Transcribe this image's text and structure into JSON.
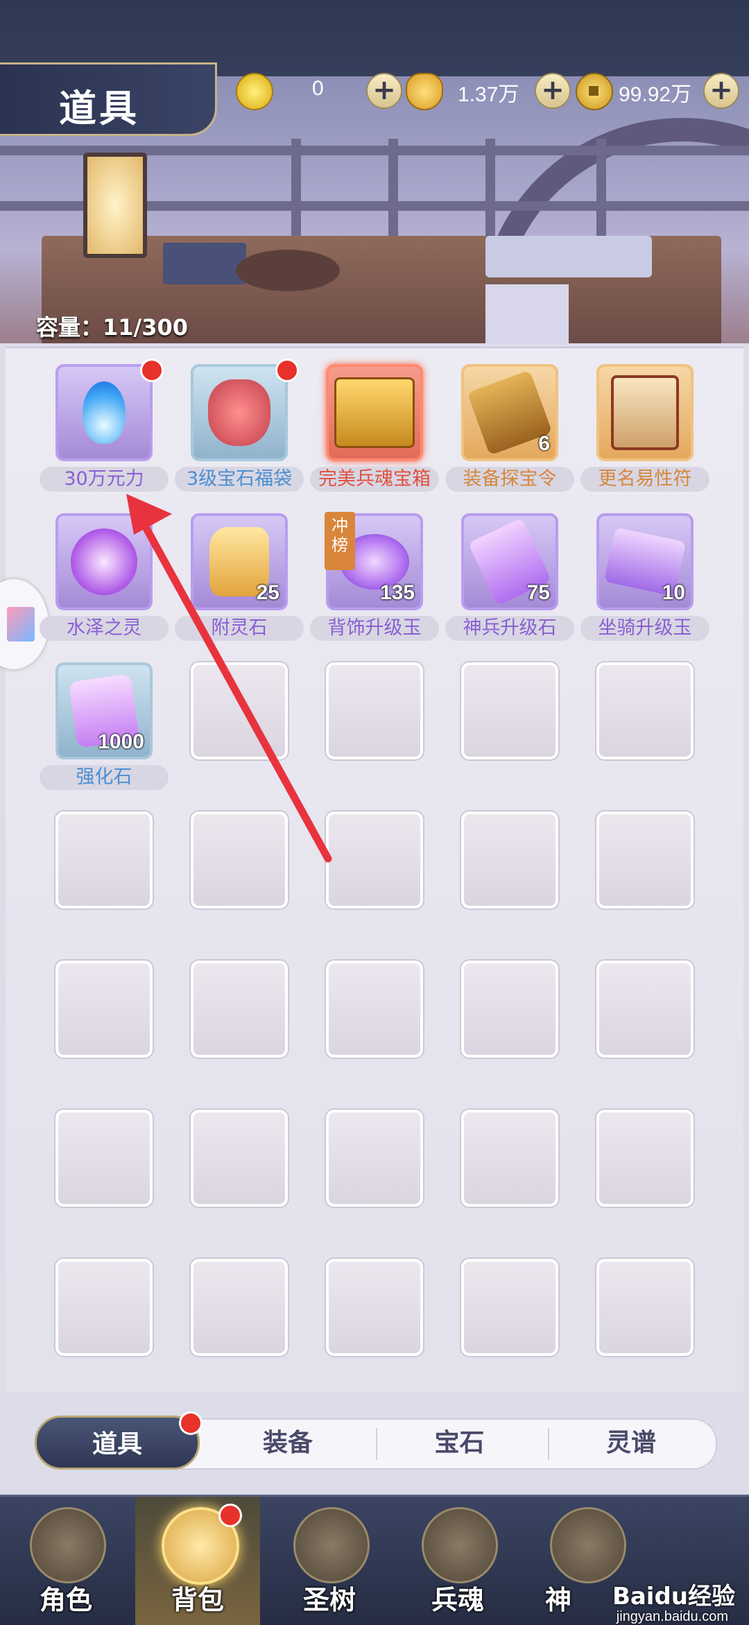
{
  "header": {
    "title": "道具"
  },
  "currencies": [
    {
      "icon": "gold-coin-icon",
      "value": "0"
    },
    {
      "icon": "gold-ingot-icon",
      "value": "1.37万"
    },
    {
      "icon": "copper-coin-icon",
      "value": "99.92万"
    }
  ],
  "inventory": {
    "capacity_label": "容量：11/300",
    "items": [
      {
        "name": "30万元力",
        "icon": "blue-flame-icon",
        "rarity": "purple",
        "count": "",
        "new": true
      },
      {
        "name": "3级宝石福袋",
        "icon": "gem-lucky-bag-icon",
        "rarity": "blue",
        "count": "",
        "new": true
      },
      {
        "name": "完美兵魂宝箱",
        "icon": "treasure-chest-icon",
        "rarity": "red",
        "count": "",
        "new": false
      },
      {
        "name": "装备探宝令",
        "icon": "treasure-token-icon",
        "rarity": "orange",
        "count": "6",
        "new": false
      },
      {
        "name": "更名易性符",
        "icon": "rename-card-icon",
        "rarity": "orange",
        "count": "",
        "new": false
      },
      {
        "name": "水泽之灵",
        "icon": "water-spirit-orb-icon",
        "rarity": "purple",
        "count": "",
        "new": false
      },
      {
        "name": "附灵石",
        "icon": "spirit-stone-icon",
        "rarity": "purple",
        "count": "25",
        "new": false
      },
      {
        "name": "背饰升级玉",
        "icon": "back-jade-icon",
        "rarity": "purple",
        "count": "135",
        "new": false,
        "badge": "冲榜"
      },
      {
        "name": "神兵升级石",
        "icon": "weapon-stone-icon",
        "rarity": "purple",
        "count": "75",
        "new": false
      },
      {
        "name": "坐骑升级玉",
        "icon": "mount-jade-icon",
        "rarity": "purple",
        "count": "10",
        "new": false
      },
      {
        "name": "强化石",
        "icon": "enhance-stone-icon",
        "rarity": "blue",
        "count": "1000",
        "new": false
      }
    ]
  },
  "category_tabs": [
    {
      "label": "道具",
      "selected": true,
      "new": true
    },
    {
      "label": "装备",
      "selected": false
    },
    {
      "label": "宝石",
      "selected": false
    },
    {
      "label": "灵谱",
      "selected": false
    }
  ],
  "bottom_nav": [
    {
      "label": "角色",
      "icon": "character-icon",
      "selected": false
    },
    {
      "label": "背包",
      "icon": "backpack-icon",
      "selected": true,
      "new": true
    },
    {
      "label": "圣树",
      "icon": "holy-tree-icon",
      "selected": false
    },
    {
      "label": "兵魂",
      "icon": "weapon-soul-icon",
      "selected": false
    },
    {
      "label": "神",
      "icon": "deity-icon",
      "selected": false
    }
  ],
  "watermark": {
    "text": "Baidu经验",
    "sub": "jingyan.baidu.com"
  },
  "annotation": {
    "color": "#e8333e"
  }
}
